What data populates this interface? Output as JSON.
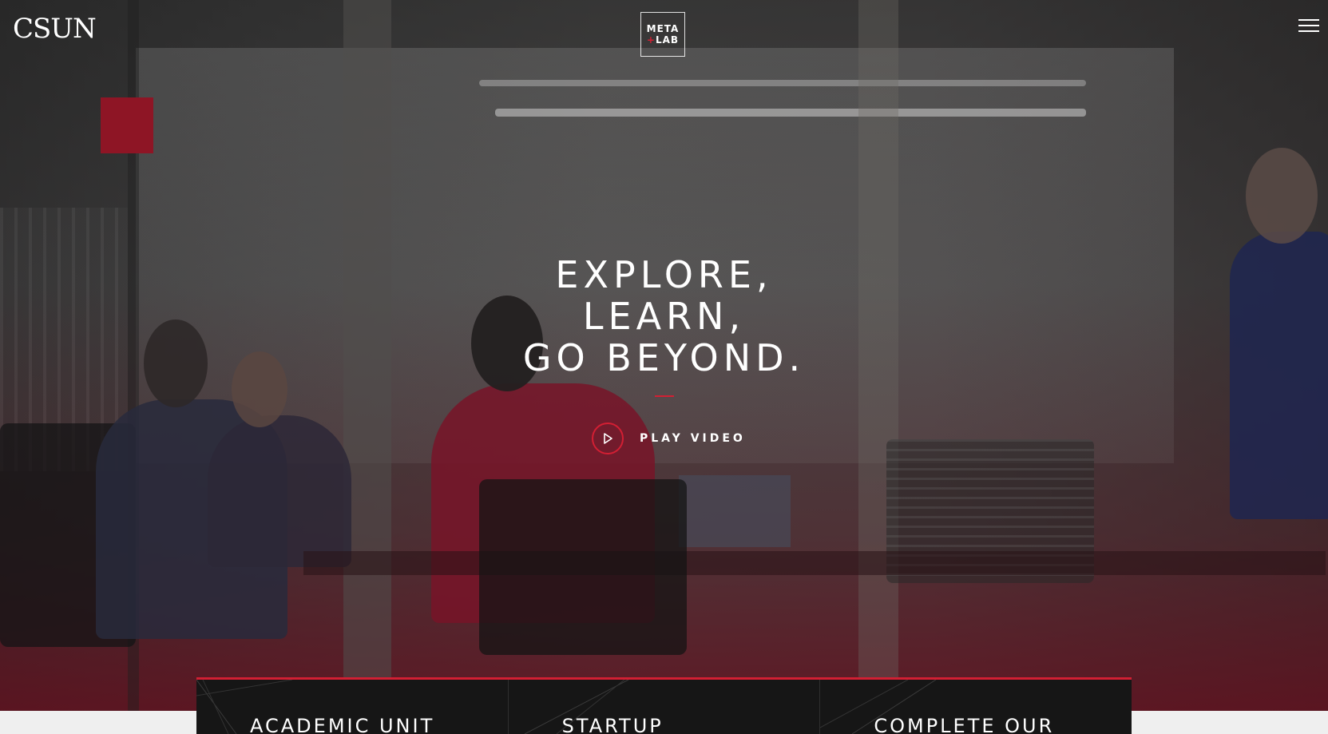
{
  "header": {
    "university_logo": "CSUN",
    "lab_logo": {
      "line1": "META",
      "plus": "+",
      "line2": "LAB"
    },
    "menu_icon": "hamburger-menu-icon"
  },
  "hero": {
    "headline": [
      "EXPLORE,",
      "LEARN,",
      "GO BEYOND."
    ],
    "play_label": "PLAY VIDEO",
    "play_icon": "play-icon"
  },
  "cards": [
    {
      "title": "ACADEMIC UNIT"
    },
    {
      "title": "STARTUP"
    },
    {
      "title": "COMPLETE OUR"
    }
  ],
  "colors": {
    "accent": "#d21f33",
    "card_bg": "#161616",
    "text": "#ffffff"
  }
}
